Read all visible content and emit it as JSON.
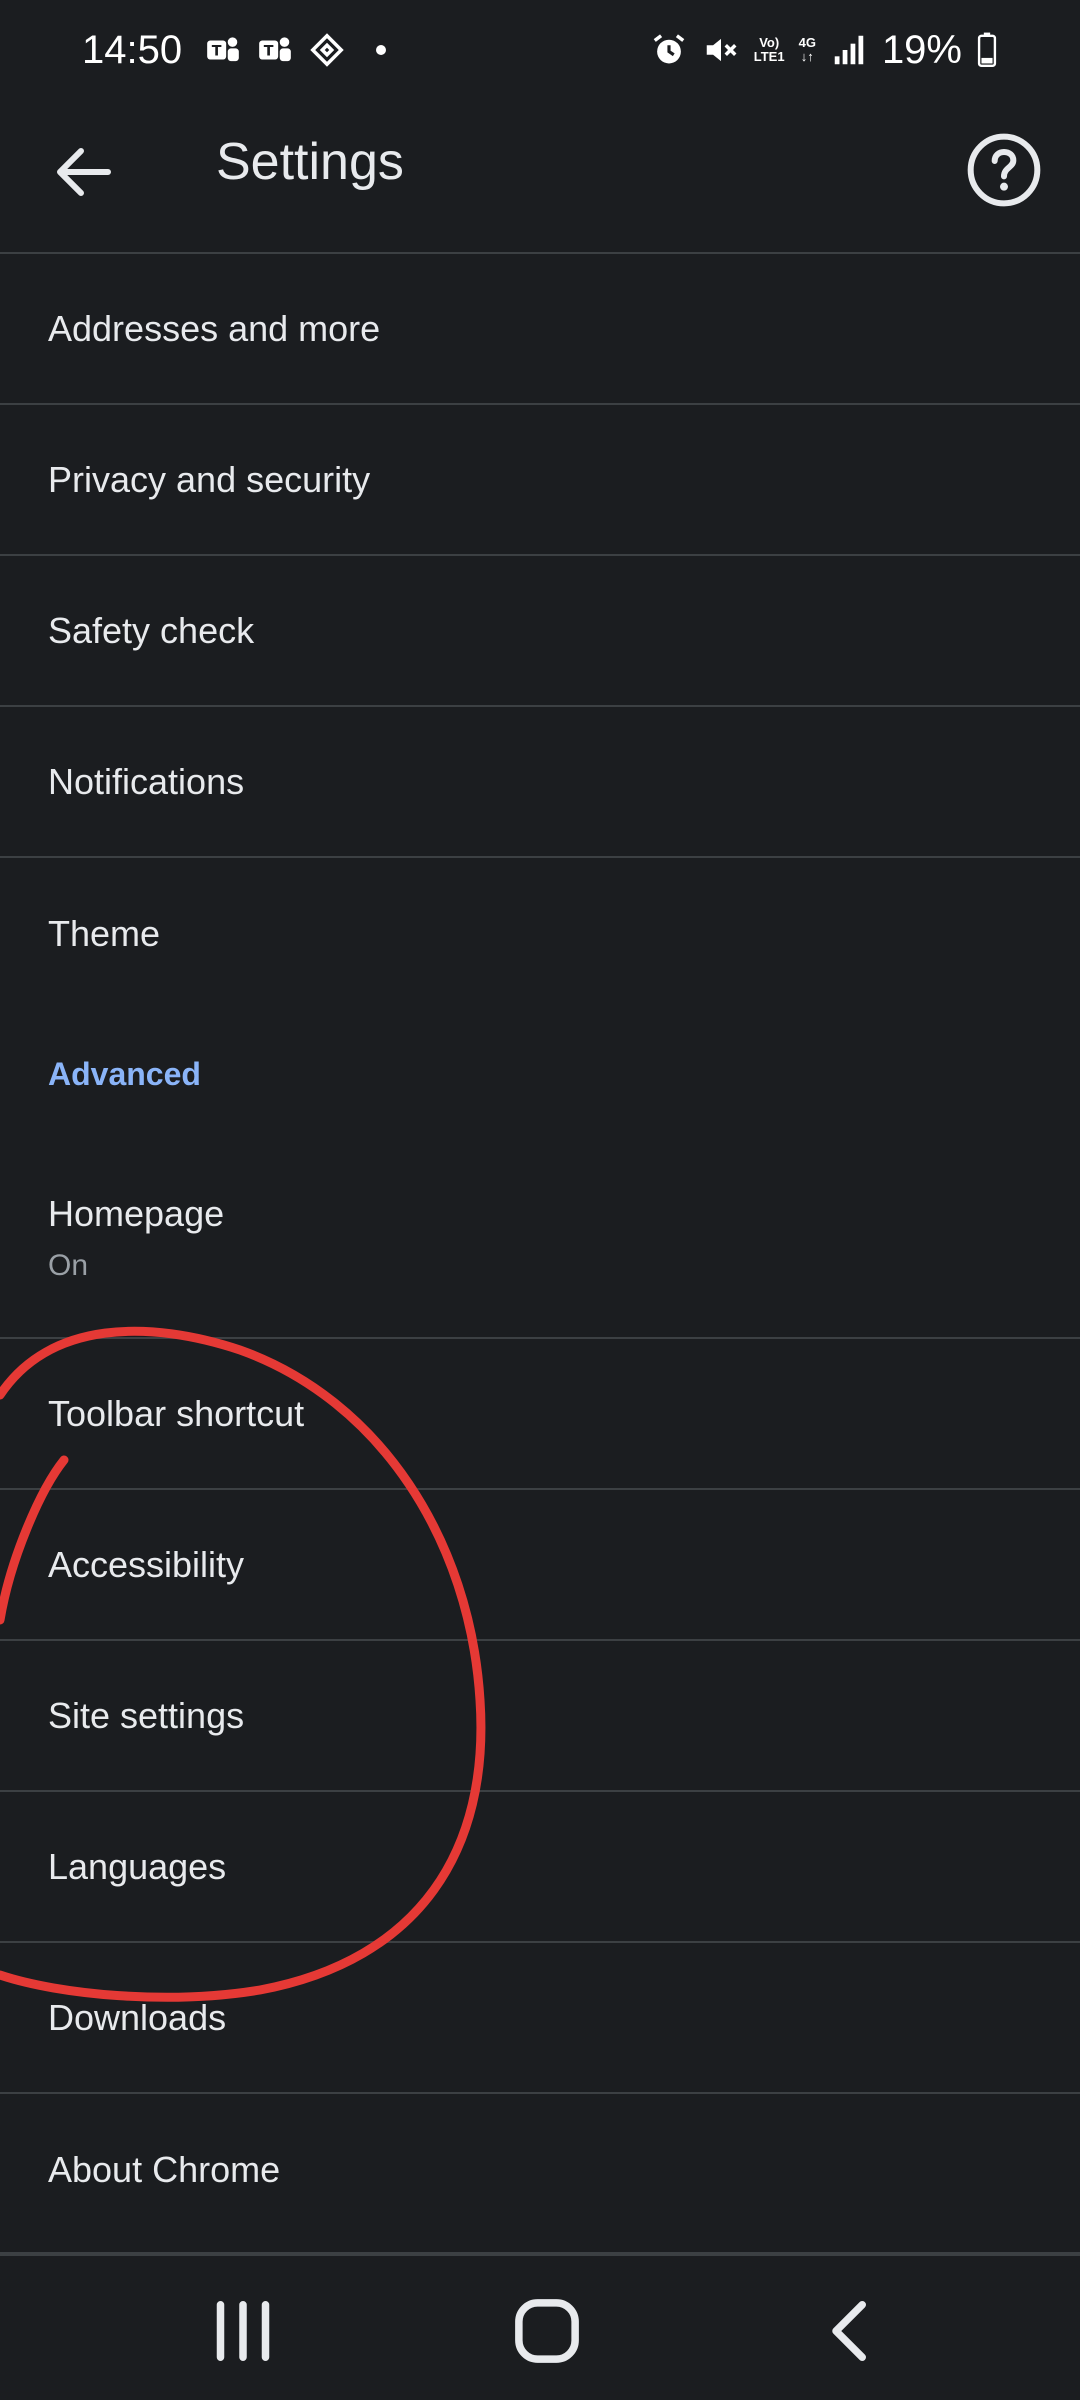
{
  "status_bar": {
    "time": "14:50",
    "battery": "19%",
    "network_top": "Vo)",
    "network_bottom": "LTE1",
    "network_type": "4G",
    "icons": [
      "teams-icon",
      "teams-icon",
      "binance-icon",
      "notification-dot",
      "alarm-icon",
      "mute-icon",
      "volte-icon",
      "4g-icon",
      "signal-icon",
      "battery-icon"
    ]
  },
  "app_bar": {
    "title": "Settings",
    "back_icon": "arrow-left-icon",
    "help_icon": "help-circle-icon"
  },
  "list": {
    "items_top": [
      {
        "label": "Addresses and more"
      },
      {
        "label": "Privacy and security"
      },
      {
        "label": "Safety check"
      },
      {
        "label": "Notifications"
      },
      {
        "label": "Theme"
      }
    ],
    "section_header": "Advanced",
    "homepage": {
      "label": "Homepage",
      "sub": "On"
    },
    "items_bottom": [
      {
        "label": "Toolbar shortcut"
      },
      {
        "label": "Accessibility"
      },
      {
        "label": "Site settings"
      },
      {
        "label": "Languages"
      },
      {
        "label": "Downloads"
      },
      {
        "label": "About Chrome"
      }
    ]
  },
  "nav_bar": {
    "recents_icon": "recents-icon",
    "home_icon": "home-icon",
    "back_icon": "back-chevron-icon"
  },
  "colors": {
    "background": "#1b1d20",
    "text": "#e8eaed",
    "divider": "#3c4043",
    "accent": "#8ab4f8",
    "annotation": "#e53935"
  }
}
